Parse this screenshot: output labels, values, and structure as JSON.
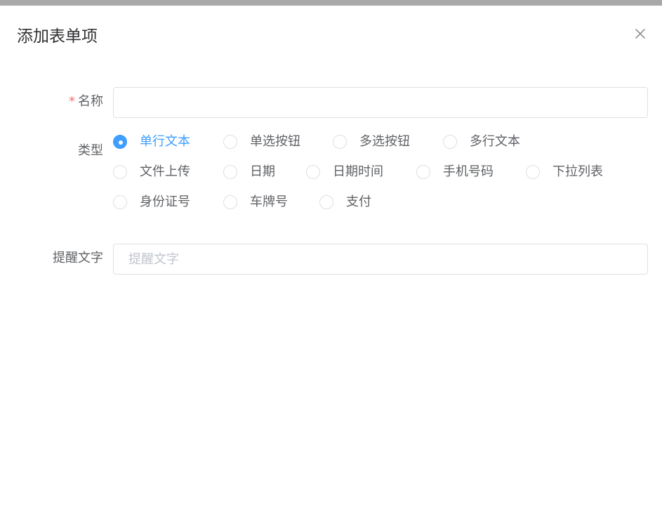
{
  "dialog": {
    "title": "添加表单项",
    "close_icon": "close-icon"
  },
  "form": {
    "name": {
      "required_mark": "*",
      "label": "名称",
      "value": "",
      "placeholder": ""
    },
    "type": {
      "label": "类型",
      "selected": "单行文本",
      "options": [
        "单行文本",
        "单选按钮",
        "多选按钮",
        "多行文本",
        "文件上传",
        "日期",
        "日期时间",
        "手机号码",
        "下拉列表",
        "身份证号",
        "车牌号",
        "支付"
      ]
    },
    "hint": {
      "label": "提醒文字",
      "value": "",
      "placeholder": "提醒文字"
    }
  },
  "colors": {
    "primary": "#409eff",
    "required": "#f56c6c",
    "text": "#606266",
    "title": "#303133",
    "border": "#dcdfe6",
    "placeholder": "#c0c4cc"
  }
}
